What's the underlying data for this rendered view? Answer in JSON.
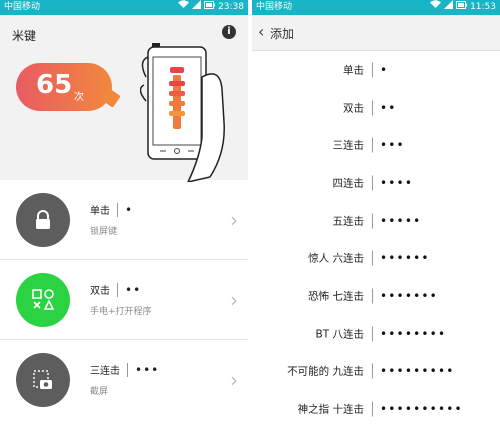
{
  "left": {
    "status": {
      "carrier": "中国移动",
      "time": "23:38"
    },
    "title": "米键",
    "count": {
      "number": "65",
      "unit": "次"
    },
    "items": [
      {
        "name": "单击",
        "dots": "•",
        "desc": "锁屏键",
        "icon": "lock-icon",
        "color": "#5d5d5d"
      },
      {
        "name": "双击",
        "dots": "••",
        "desc": "手电+打开程序",
        "icon": "apps-icon",
        "color": "#2bd342"
      },
      {
        "name": "三连击",
        "dots": "•••",
        "desc": "截屏",
        "icon": "screenshot-icon",
        "color": "#5d5d5d"
      }
    ]
  },
  "right": {
    "status": {
      "carrier": "中国移动",
      "time": "11:53"
    },
    "header": {
      "title": "添加"
    },
    "clicks": [
      {
        "name": "单击",
        "dots": "•"
      },
      {
        "name": "双击",
        "dots": "••"
      },
      {
        "name": "三连击",
        "dots": "•••"
      },
      {
        "name": "四连击",
        "dots": "••••"
      },
      {
        "name": "五连击",
        "dots": "•••••"
      },
      {
        "name": "惊人 六连击",
        "dots": "••••••"
      },
      {
        "name": "恐怖 七连击",
        "dots": "•••••••"
      },
      {
        "name": "BT 八连击",
        "dots": "••••••••"
      },
      {
        "name": "不可能的 九连击",
        "dots": "•••••••••"
      },
      {
        "name": "神之指 十连击",
        "dots": "••••••••••"
      }
    ]
  },
  "colors": {
    "statusbar": "#18b5c6",
    "accent_gradient": [
      "#e95a63",
      "#f2883c"
    ],
    "green": "#2bd342"
  }
}
